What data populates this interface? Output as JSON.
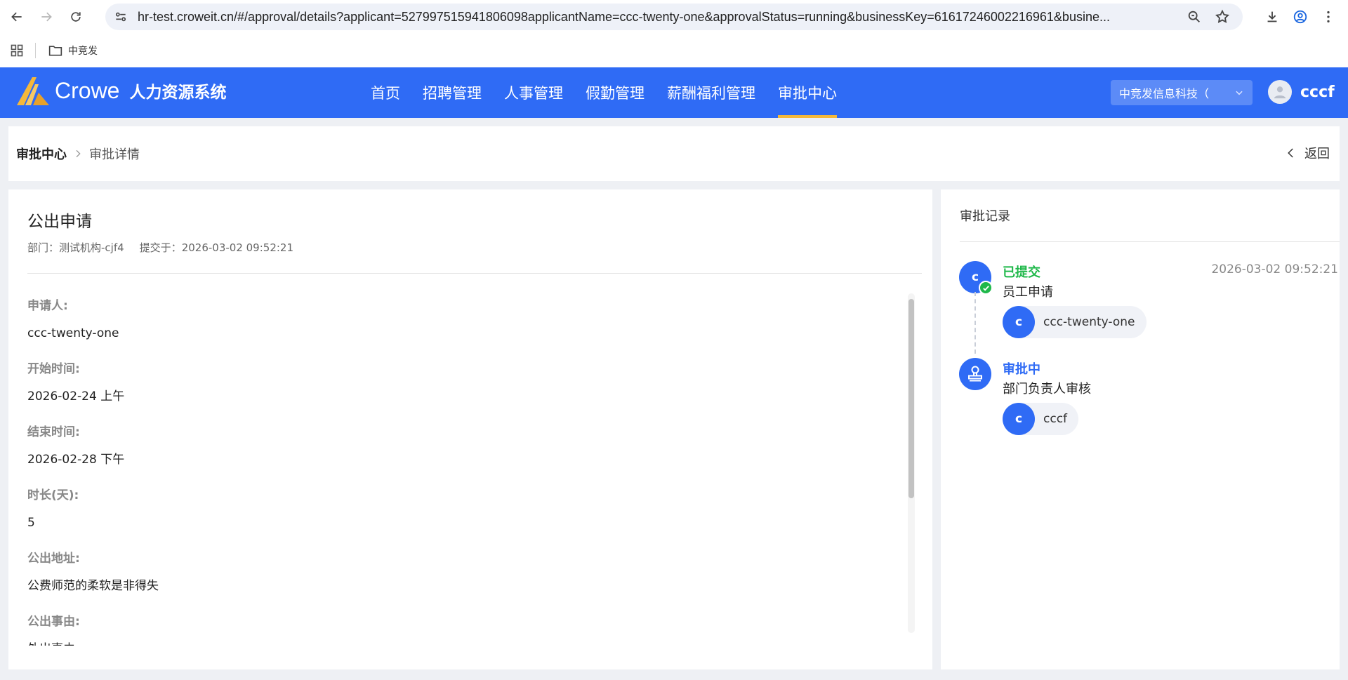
{
  "browser": {
    "url": "hr-test.croweit.cn/#/approval/details?applicant=527997515941806098applicantName=ccc-twenty-one&approvalStatus=running&businessKey=61617246002216961&busine...",
    "bookmark_folder": "中竞发",
    "icons": [
      "back-icon",
      "forward-icon",
      "reload-icon",
      "site-settings-icon",
      "zoom-icon",
      "star-icon",
      "download-icon",
      "profile-icon",
      "menu-dots-icon",
      "apps-grid-icon",
      "folder-icon"
    ]
  },
  "header": {
    "brand": "Crowe",
    "system_name": "人力资源系统",
    "nav": [
      "首页",
      "招聘管理",
      "人事管理",
      "假勤管理",
      "薪酬福利管理",
      "审批中心"
    ],
    "active_nav": "审批中心",
    "org_select": "中竞发信息科技（",
    "user_name": "cccf",
    "colors": {
      "primary": "#2f6bf5",
      "active_underline": "#f5b83a"
    }
  },
  "breadcrumb": {
    "root": "审批中心",
    "current": "审批详情",
    "back_label": "返回"
  },
  "detail": {
    "title": "公出申请",
    "department_label": "部门：",
    "department": "测试机构-cjf4",
    "submitted_label": "提交于：",
    "submitted_at": "2026-03-02 09:52:21",
    "fields": [
      {
        "label": "申请人:",
        "value": "ccc-twenty-one"
      },
      {
        "label": "开始时间:",
        "value": "2026-02-24 上午"
      },
      {
        "label": "结束时间:",
        "value": "2026-02-28 下午"
      },
      {
        "label": "时长(天):",
        "value": "5"
      },
      {
        "label": "公出地址:",
        "value": "公费师范的柔软是非得失"
      },
      {
        "label": "公出事由:",
        "value": "外出事由"
      }
    ]
  },
  "record": {
    "title": "审批记录",
    "steps": [
      {
        "status": "已提交",
        "description": "员工申请",
        "time": "2026-03-02 09:52:21",
        "node_letter": "c",
        "person_initial": "c",
        "person_name": "ccc-twenty-one"
      },
      {
        "status": "审批中",
        "description": "部门负责人审核",
        "time": "",
        "person_initial": "c",
        "person_name": "cccf"
      }
    ],
    "colors": {
      "done": "#1fb84a",
      "running": "#2f6bf5"
    }
  }
}
